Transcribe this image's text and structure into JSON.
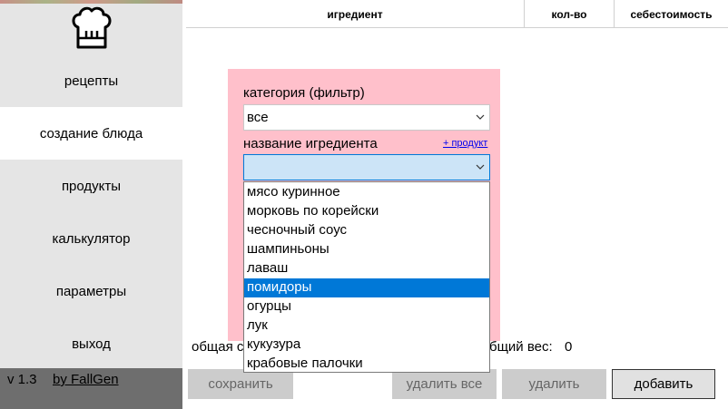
{
  "sidebar": {
    "nav": [
      {
        "label": "рецепты"
      },
      {
        "label": "создание блюда"
      },
      {
        "label": "продукты"
      },
      {
        "label": "калькулятор"
      },
      {
        "label": "параметры"
      },
      {
        "label": "выход"
      }
    ],
    "version": "v 1.3",
    "author": "by FallGen"
  },
  "table": {
    "columns": [
      "игредиент",
      "кол-во",
      "себестоимость"
    ]
  },
  "form": {
    "category_label": "категория (фильтр)",
    "category_value": "все",
    "ingredient_label": "название игредиента",
    "add_product_link": "+ продукт",
    "ingredient_value": ""
  },
  "dropdown": {
    "options": [
      "мясо куринное",
      "морковь по корейски",
      "чесночный соус",
      "шампиньоны",
      "лаваш",
      "помидоры",
      "огурцы",
      "лук",
      "кукузура",
      "крабовые палочки"
    ],
    "selected": "помидоры"
  },
  "stats": {
    "cost_label_partial": "общая с",
    "weight_label_partial": "бщий вес:",
    "weight_value": "0"
  },
  "buttons": {
    "save": "сохранить",
    "delete_all": "удалить все",
    "delete": "удалить",
    "add": "добавить"
  },
  "colors": {
    "panel": "#ffc0cb",
    "selection": "#0078d7",
    "sidebar": "#e5e5e5",
    "footer": "#6e6e6e"
  }
}
